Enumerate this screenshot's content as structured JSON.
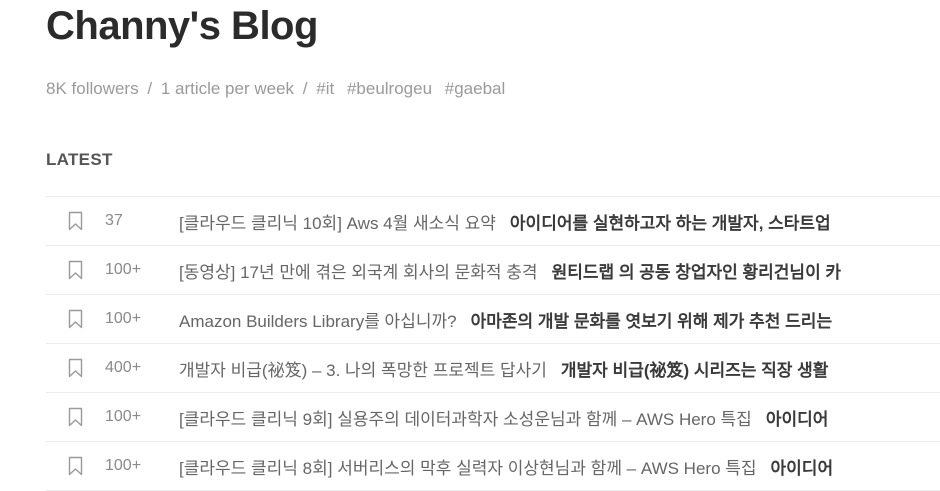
{
  "blog": {
    "title": "Channy's Blog",
    "followers": "8K followers",
    "frequency": "1 article per week",
    "separator": "/",
    "tags": [
      "#it",
      "#beulrogeu",
      "#gaebal"
    ]
  },
  "section": {
    "label": "LATEST"
  },
  "articles": [
    {
      "count": "37",
      "title": "[클라우드 클리닉 10회] Aws 4월 새소식 요약",
      "subtitle": "아이디어를 실현하고자 하는 개발자, 스타트업"
    },
    {
      "count": "100+",
      "title": "[동영상] 17년 만에 겪은 외국계 회사의 문화적 충격",
      "subtitle": "원티드랩 의 공동 창업자인 황리건님이 카"
    },
    {
      "count": "100+",
      "title": "Amazon Builders Library를 아십니까?",
      "subtitle": "아마존의 개발 문화를 엿보기 위해 제가 추천 드리는"
    },
    {
      "count": "400+",
      "title": "개발자 비급(祕笈) – 3. 나의 폭망한 프로젝트 답사기",
      "subtitle": "개발자 비급(祕笈) 시리즈는 직장 생활"
    },
    {
      "count": "100+",
      "title": "[클라우드 클리닉 9회] 실용주의 데이터과학자 소성운님과 함께 – AWS Hero 특집",
      "subtitle": "아이디어"
    },
    {
      "count": "100+",
      "title": "[클라우드 클리닉 8회] 서버리스의 막후 실력자 이상현님과 함께 – AWS Hero 특집",
      "subtitle": "아이디어"
    }
  ]
}
